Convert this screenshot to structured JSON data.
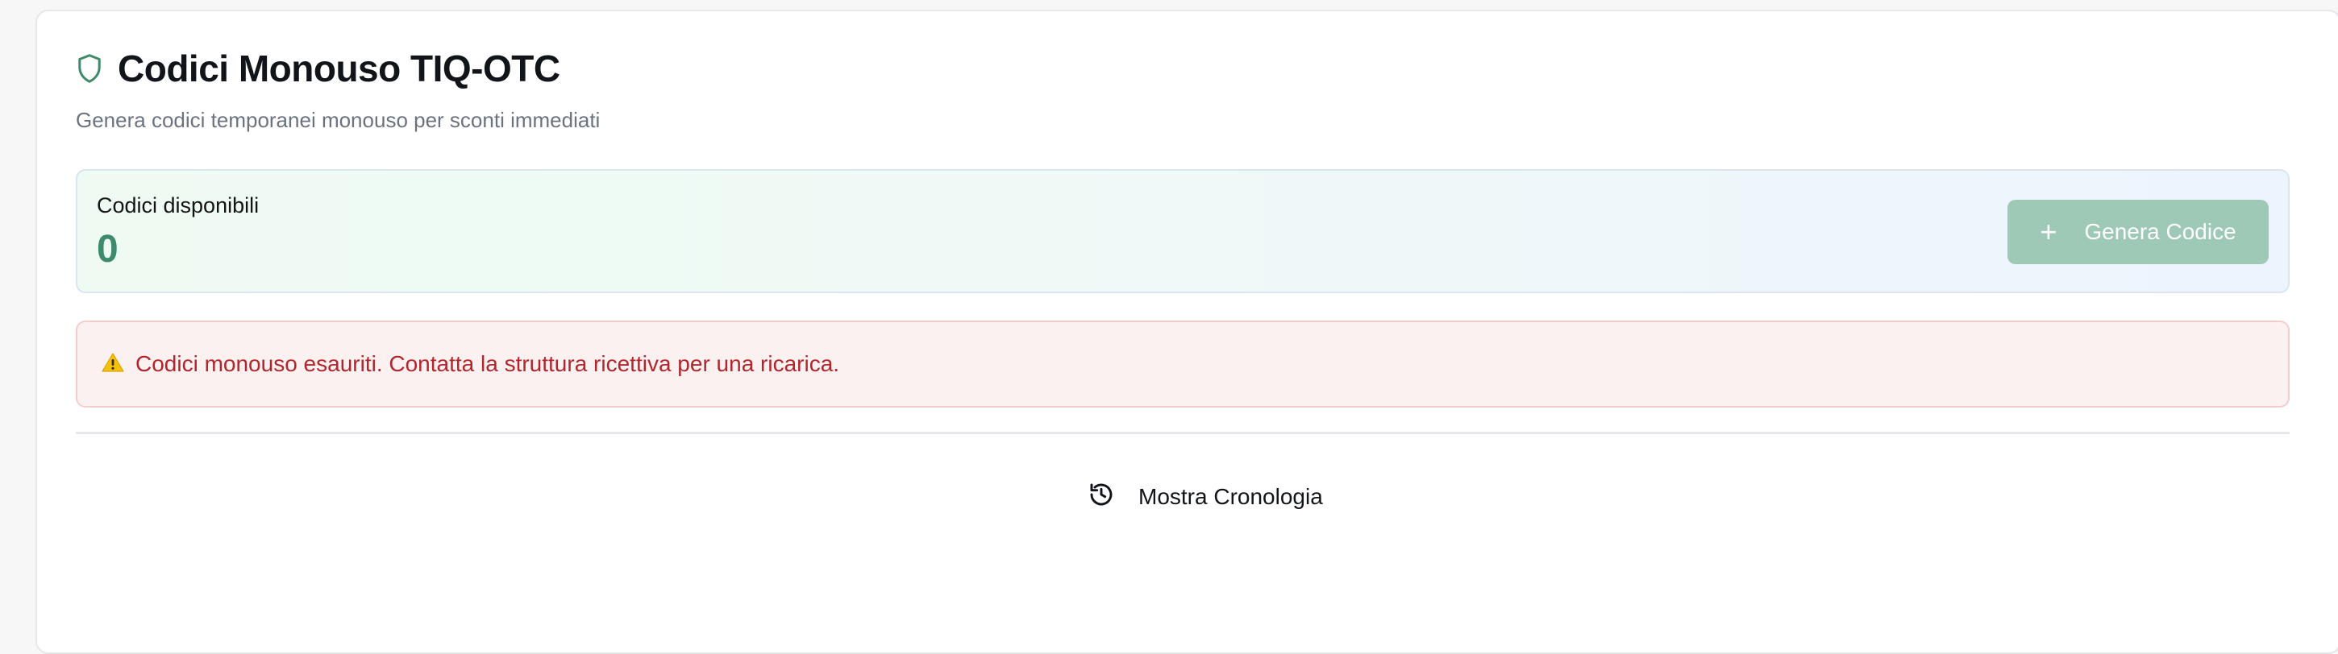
{
  "header": {
    "title": "Codici Monouso TIQ-OTC",
    "subtitle": "Genera codici temporanei monouso per sconti immediati",
    "icon": "shield-icon"
  },
  "stats": {
    "label": "Codici disponibili",
    "value": "0"
  },
  "generate_button": {
    "label": "Genera Codice",
    "icon": "plus-icon",
    "disabled": true
  },
  "alert": {
    "text": "Codici monouso esauriti. Contatta la struttura ricettiva per una ricarica.",
    "icon": "warning-icon"
  },
  "history": {
    "label": "Mostra Cronologia",
    "icon": "history-icon"
  },
  "colors": {
    "accent": "#3d8b6a",
    "button_disabled": "#9dc9b6",
    "alert_text": "#b1262c",
    "alert_bg": "#fcf1f1"
  }
}
